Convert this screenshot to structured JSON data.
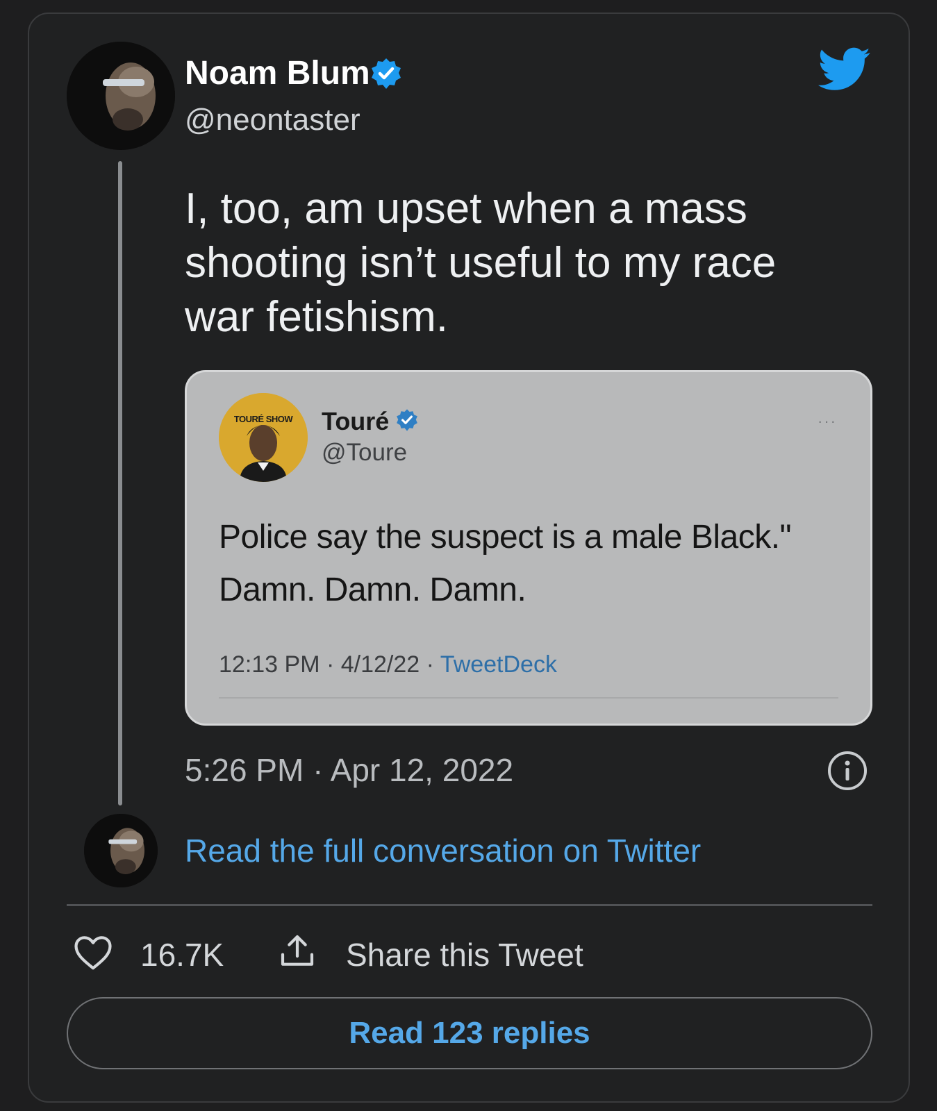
{
  "author": {
    "name": "Noam Blum",
    "handle": "@neontaster"
  },
  "tweet": {
    "text": "I, too, am upset when a mass shooting isn’t useful to my race war fetishism.",
    "timestamp": "5:26 PM · Apr 12, 2022"
  },
  "quoted_tweet": {
    "avatar_label": "TOURÉ SHOW",
    "name": "Touré",
    "handle": "@Toure",
    "more": "···",
    "text": "Police say the suspect is a male Black.\" Damn. Damn. Damn.",
    "meta_prefix": "12:13 PM · 4/12/22 · ",
    "source": "TweetDeck"
  },
  "read_full_link": "Read the full conversation on Twitter",
  "actions": {
    "like_count": "16.7K",
    "share_label": "Share this Tweet"
  },
  "replies_button": "Read 123 replies",
  "icons": {
    "brand": "twitter-bird-icon",
    "verified": "verified-badge-icon",
    "info": "info-icon",
    "like": "heart-icon",
    "share": "share-icon"
  },
  "colors": {
    "background": "#1e1e1f",
    "accent": "#55a8e8",
    "verified": "#1d9bf0",
    "twitter_blue": "#1d9bf0"
  }
}
